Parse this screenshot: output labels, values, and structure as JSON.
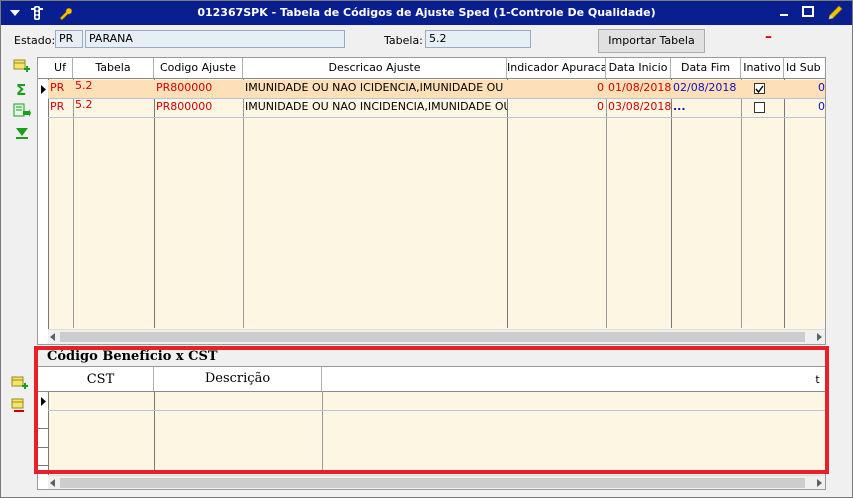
{
  "window": {
    "title": "012367SPK - Tabela de Códigos de Ajuste Sped (1-Controle De Qualidade)"
  },
  "header": {
    "estado_label": "Estado:",
    "estado_code": "PR",
    "estado_name": "PARANA",
    "tabela_label": "Tabela:",
    "tabela_value": "5.2",
    "import_button": "Importar Tabela",
    "minus_symbol": "–"
  },
  "main_grid": {
    "columns": [
      "Uf",
      "Tabela",
      "Codigo Ajuste",
      "Descricao Ajuste",
      "Indicador Apuracao",
      "Data Inicio",
      "Data Fim",
      "Inativo",
      "Id Sub It"
    ],
    "rows": [
      {
        "uf": "PR",
        "tabela": "5.2",
        "codigo": "PR800000",
        "descricao": "IMUNIDADE OU NAO ICIDENCIA,IMUNIDADE OU NAO",
        "indicador": "0",
        "data_inicio": "01/08/2018",
        "data_fim": "02/08/2018",
        "inativo": true,
        "id_sub": "0"
      },
      {
        "uf": "PR",
        "tabela": "5.2",
        "codigo": "PR800000",
        "descricao": "IMUNIDADE OU NAO INCIDENCIA,IMUNIDADE OU NAO",
        "indicador": "0",
        "data_inicio": "03/08/2018",
        "data_fim": "...",
        "inativo": false,
        "id_sub": "0"
      }
    ]
  },
  "sub_section": {
    "title": "Código Benefício x CST",
    "columns": [
      "CST",
      "Descrição"
    ],
    "trailing_header_char": "t"
  },
  "colors": {
    "titlebar": "#0a1f8f",
    "row_selected": "#fde0b8",
    "grid_bg": "#fdf6e3",
    "highlight": "#e8202a",
    "data_red": "#d40000",
    "data_blue": "#1010c0"
  }
}
